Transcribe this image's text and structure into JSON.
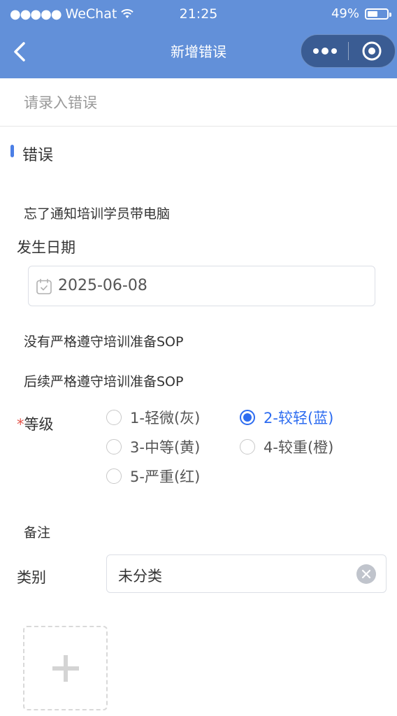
{
  "status_bar": {
    "carrier": "WeChat",
    "signal_dots": "●●●●●",
    "time": "21:25",
    "battery_percent": "49%",
    "battery_level": 0.49
  },
  "nav": {
    "title": "新增错误",
    "back_icon": "chevron-left-icon",
    "more_icon": "more-dots-icon",
    "close_icon": "target-circle-icon"
  },
  "error_input": {
    "placeholder": "请录入错误",
    "value": ""
  },
  "section": {
    "title": "错误",
    "accent_color": "#4b7fe6"
  },
  "error_text": "忘了通知培训学员带电脑",
  "date_field": {
    "label": "发生日期",
    "value": "2025-06-08",
    "icon": "calendar-icon"
  },
  "cause_text": "没有严格遵守培训准备SOP",
  "followup_text": "后续严格遵守培训准备SOP",
  "level": {
    "required_mark": "*",
    "label": "等级",
    "options": [
      {
        "label": "1-轻微(灰)",
        "checked": false
      },
      {
        "label": "2-较轻(蓝)",
        "checked": true
      },
      {
        "label": "3-中等(黄)",
        "checked": false
      },
      {
        "label": "4-较重(橙)",
        "checked": false
      },
      {
        "label": "5-严重(红)",
        "checked": false
      }
    ],
    "selected_color": "#2d6cf0"
  },
  "remark_label": "备注",
  "category": {
    "label": "类别",
    "value": "未分类",
    "clear_icon": "clear-x-icon"
  },
  "upload": {
    "icon": "plus-icon"
  },
  "colors": {
    "header_bg": "#6290d9",
    "capsule_bg": "#3a5c93"
  }
}
